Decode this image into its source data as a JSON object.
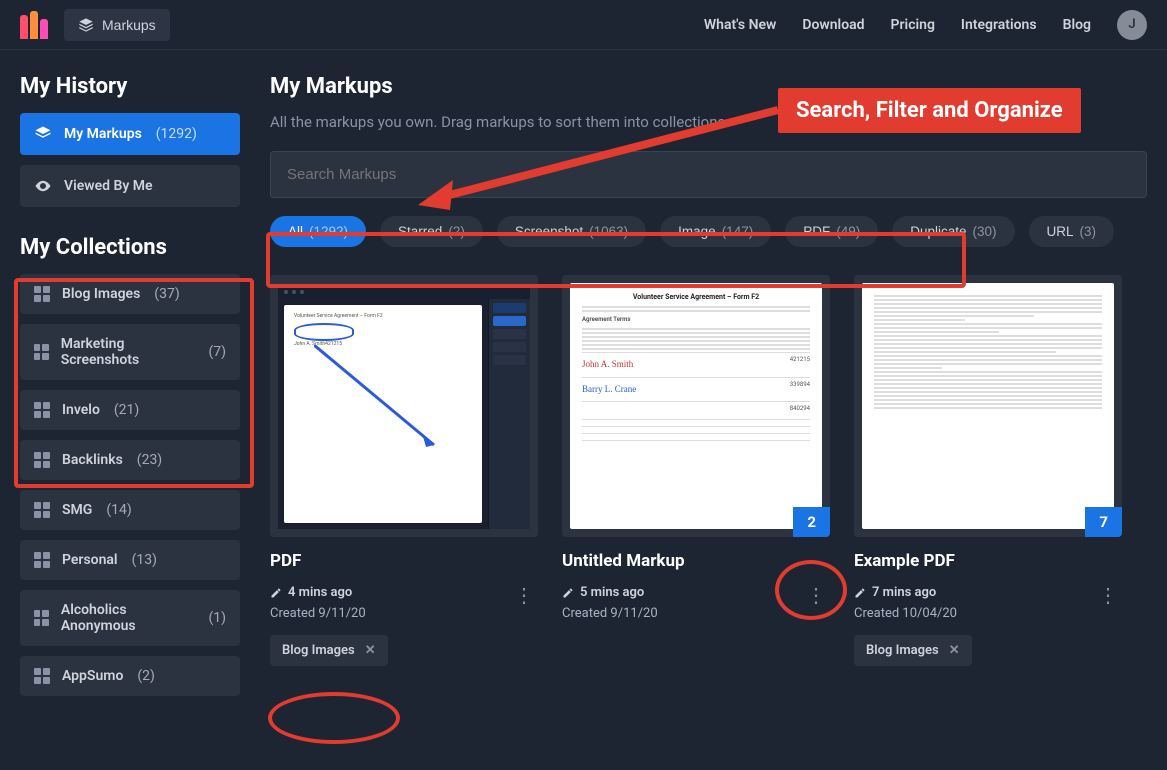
{
  "nav": {
    "markups_btn": "Markups",
    "links": [
      "What's New",
      "Download",
      "Pricing",
      "Integrations",
      "Blog"
    ],
    "avatar_initial": "J"
  },
  "sidebar": {
    "history_heading": "My History",
    "my_markups": {
      "label": "My Markups",
      "count": "(1292)"
    },
    "viewed_by_me": {
      "label": "Viewed By Me"
    },
    "collections_heading": "My Collections",
    "collections": [
      {
        "label": "Blog Images",
        "count": "(37)"
      },
      {
        "label": "Marketing Screenshots",
        "count": "(7)"
      },
      {
        "label": "Invelo",
        "count": "(21)"
      },
      {
        "label": "Backlinks",
        "count": "(23)"
      },
      {
        "label": "SMG",
        "count": "(14)"
      },
      {
        "label": "Personal",
        "count": "(13)"
      },
      {
        "label": "Alcoholics Anonymous",
        "count": "(1)"
      },
      {
        "label": "AppSumo",
        "count": "(2)"
      }
    ]
  },
  "main": {
    "heading": "My Markups",
    "subtitle": "All the markups you own. Drag markups to sort them into collections.",
    "search_placeholder": "Search Markups",
    "filters": [
      {
        "label": "All",
        "count": "(1292)",
        "active": true
      },
      {
        "label": "Starred",
        "count": "(2)"
      },
      {
        "label": "Screenshot",
        "count": "(1063)"
      },
      {
        "label": "Image",
        "count": "(147)"
      },
      {
        "label": "PDF",
        "count": "(49)"
      },
      {
        "label": "Duplicate",
        "count": "(30)"
      },
      {
        "label": "URL",
        "count": "(3)"
      }
    ]
  },
  "cards": [
    {
      "title": "PDF",
      "edited": "4 mins ago",
      "created": "Created 9/11/20",
      "tag": "Blog Images",
      "doc_title": "Volunteer Service Agreement – Form F2",
      "sig1": "John A. Smith",
      "sig_num1": "421215"
    },
    {
      "title": "Untitled Markup",
      "edited": "5 mins ago",
      "created": "Created 9/11/20",
      "badge": "2",
      "doc_title": "Volunteer Service Agreement – Form F2",
      "sig1": "John A. Smith",
      "sig2": "Barry L. Crane",
      "sig_num1": "421215",
      "sig_num2": "339894",
      "sig_num3": "840294"
    },
    {
      "title": "Example PDF",
      "edited": "7 mins ago",
      "created": "Created 10/04/20",
      "badge": "7",
      "tag": "Blog Images"
    }
  ],
  "annotation": {
    "callout": "Search, Filter and Organize"
  }
}
